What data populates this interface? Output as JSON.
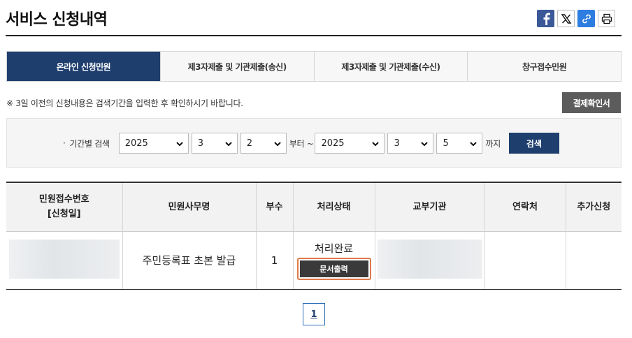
{
  "page": {
    "title": "서비스 신청내역"
  },
  "share": {
    "icons": [
      "facebook-icon",
      "x-icon",
      "link-icon",
      "print-icon"
    ]
  },
  "tabs": [
    {
      "label": "온라인 신청민원",
      "active": true
    },
    {
      "label": "제3자제출 및 기관제출(송신)",
      "active": false
    },
    {
      "label": "제3자제출 및 기관제출(수신)",
      "active": false
    },
    {
      "label": "창구접수민원",
      "active": false
    }
  ],
  "notice": "※ 3일 이전의 신청내용은 검색기간을 입력한 후 확인하시기 바랍니다.",
  "receipt_button": "결제확인서",
  "search": {
    "label": "기간별 검색",
    "from_year": "2025",
    "from_month": "3",
    "from_day": "2",
    "from_suffix": "부터 ~",
    "to_year": "2025",
    "to_month": "3",
    "to_day": "5",
    "to_suffix": "까지",
    "button": "검색"
  },
  "table": {
    "headers": [
      "민원접수번호",
      "[신청일]",
      "민원사무명",
      "부수",
      "처리상태",
      "교부기관",
      "연락처",
      "추가신청"
    ],
    "rows": [
      {
        "service_name": "주민등록표 초본 발급",
        "copies": "1",
        "status": "처리완료",
        "print_button": "문서출력"
      }
    ]
  },
  "pagination": {
    "current": "1"
  },
  "colors": {
    "navy": "#1e3e6e",
    "highlight": "#e07a4a"
  }
}
